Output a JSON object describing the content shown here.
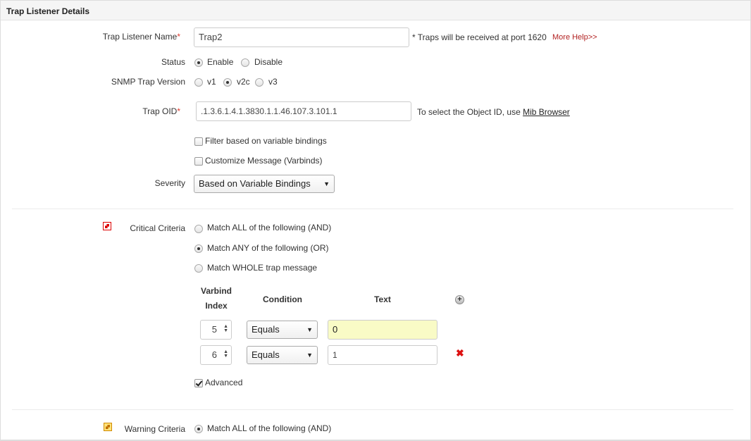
{
  "panel": {
    "title": "Trap Listener Details"
  },
  "form": {
    "name_label": "Trap Listener Name",
    "required_mark": "*",
    "name_value": "Trap2",
    "port_note": "* Traps will be received at port 1620",
    "more_help": "More Help>>",
    "status_label": "Status",
    "status_enable": "Enable",
    "status_disable": "Disable",
    "status_selected": "Enable",
    "snmp_label": "SNMP Trap Version",
    "snmp_v1": "v1",
    "snmp_v2c": "v2c",
    "snmp_v3": "v3",
    "snmp_selected": "v2c",
    "oid_label": "Trap OID",
    "oid_value": ".1.3.6.1.4.1.3830.1.1.46.107.3.101.1",
    "oid_note": "To select the Object ID, use",
    "mib_browser": "Mib Browser",
    "filter_label": "Filter based on variable bindings",
    "filter_checked": false,
    "customize_label": "Customize Message (Varbinds)",
    "customize_checked": false,
    "severity_label": "Severity",
    "severity_value": "Based on Variable Bindings"
  },
  "critical": {
    "label": "Critical Criteria",
    "icon": "critical-criteria-icon",
    "opt_all": "Match ALL of the following (AND)",
    "opt_any": "Match ANY of the following (OR)",
    "opt_whole": "Match WHOLE trap message",
    "selected": "Match ANY of the following (OR)",
    "table": {
      "col_index_1": "Varbind",
      "col_index_2": "Index",
      "col_condition": "Condition",
      "col_text": "Text",
      "rows": [
        {
          "index": "5",
          "condition": "Equals",
          "text": "0"
        },
        {
          "index": "6",
          "condition": "Equals",
          "text": "1"
        }
      ]
    },
    "advanced_label": "Advanced",
    "advanced_checked": true
  },
  "warning": {
    "label": "Warning Criteria",
    "icon": "warning-criteria-icon",
    "opt_all": "Match ALL of the following (AND)",
    "selected": "Match ALL of the following (AND)"
  },
  "colors": {
    "required": "#e03c31",
    "highlight_input": "#f9fbc6",
    "delete": "#dd1111"
  }
}
